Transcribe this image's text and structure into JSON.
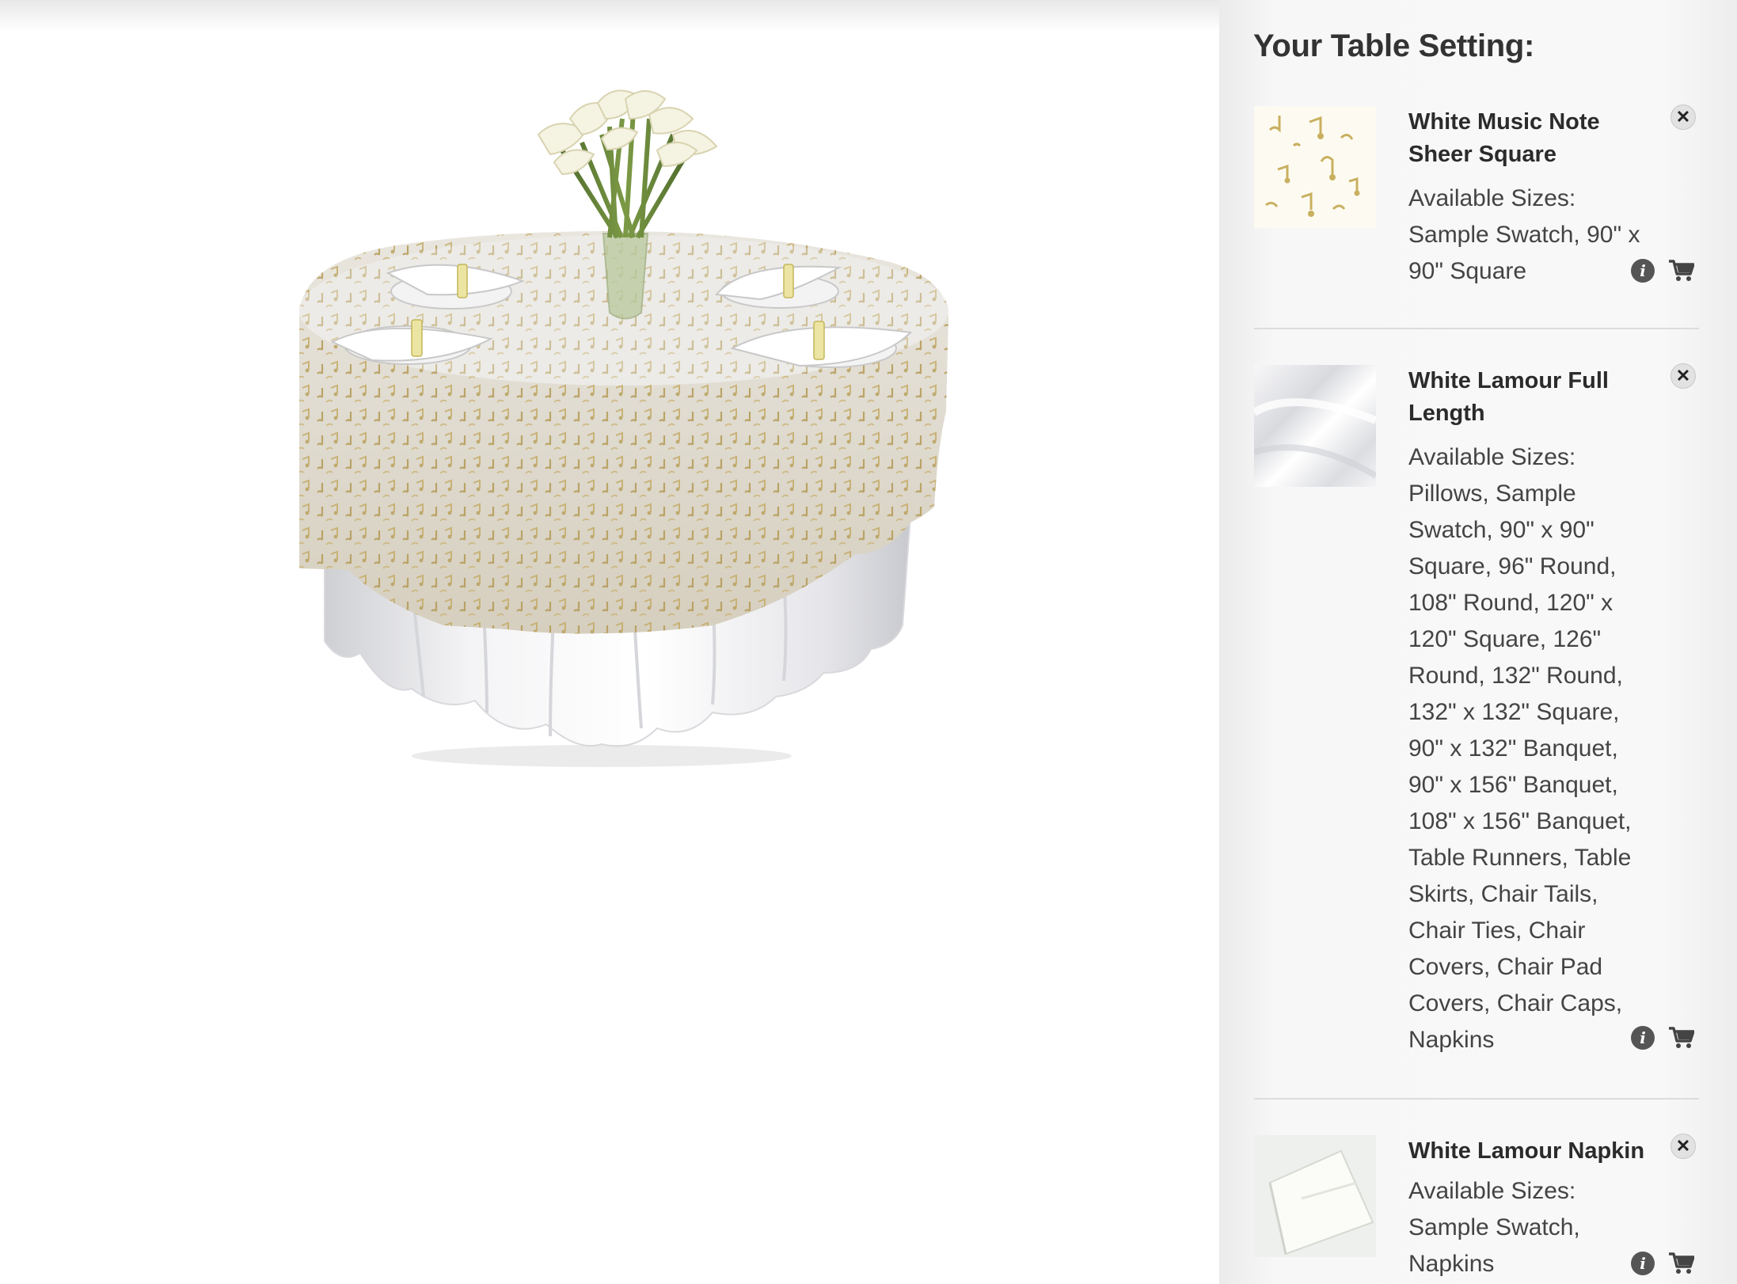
{
  "sidebar": {
    "title": "Your Table Setting:",
    "items": [
      {
        "name": "White Music Note Sheer Square",
        "sizes_label": "Available Sizes:",
        "sizes": "Sample Swatch, 90\" x 90\" Square",
        "thumb_icon": "music-note-sheer-swatch",
        "actions": [
          "remove-icon",
          "info-icon",
          "cart-icon"
        ]
      },
      {
        "name": "White Lamour Full Length",
        "sizes_label": "Available Sizes:",
        "sizes": "Pillows, Sample Swatch, 90\" x 90\" Square, 96\" Round, 108\" Round, 120\" x 120\" Square, 126\" Round, 132\" Round, 132\" x 132\" Square, 90\" x 132\" Banquet, 90\" x 156\" Banquet, 108\" x 156\" Banquet, Table Runners, Table Skirts, Chair Tails, Chair Ties, Chair Covers, Chair Pad Covers, Chair Caps, Napkins",
        "thumb_icon": "white-satin-swatch",
        "actions": [
          "remove-icon",
          "info-icon",
          "cart-icon"
        ]
      },
      {
        "name": "White Lamour Napkin",
        "sizes_label": "Available Sizes:",
        "sizes": "Sample Swatch, Napkins",
        "thumb_icon": "white-napkin-swatch",
        "actions": [
          "remove-icon",
          "info-icon",
          "cart-icon"
        ]
      }
    ]
  },
  "preview": {
    "scene": "round-table-with-music-note-overlay-and-calla-lily-centerpiece"
  },
  "colors": {
    "sidebar_bg": "#f5f5f5",
    "text": "#333333",
    "overlay_gold": "#c8b070",
    "linen_white": "#ffffff"
  }
}
